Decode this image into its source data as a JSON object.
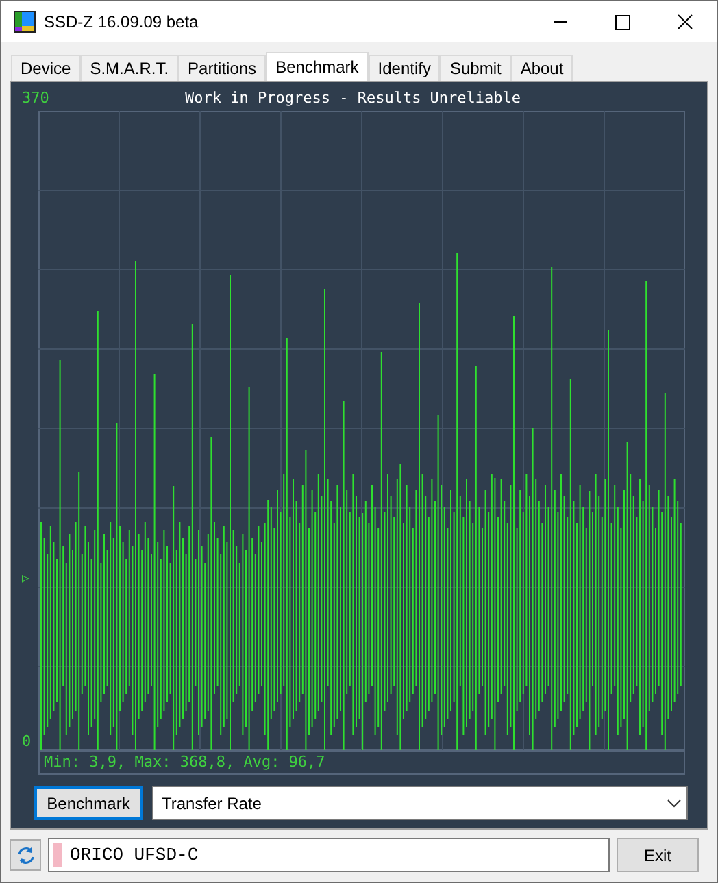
{
  "window": {
    "title": "SSD-Z 16.09.09 beta"
  },
  "tabs": [
    {
      "label": "Device",
      "selected": false
    },
    {
      "label": "S.M.A.R.T.",
      "selected": false
    },
    {
      "label": "Partitions",
      "selected": false
    },
    {
      "label": "Benchmark",
      "selected": true
    },
    {
      "label": "Identify",
      "selected": false
    },
    {
      "label": "Submit",
      "selected": false
    },
    {
      "label": "About",
      "selected": false
    }
  ],
  "graph": {
    "title": "Work in Progress - Results Unreliable",
    "y_max_label": "370",
    "y_min_label": "0",
    "marker": "▷",
    "stats": "Min: 3,9, Max: 368,8, Avg: 96,7"
  },
  "benchmark_button": "Benchmark",
  "test_select": {
    "value": "Transfer Rate"
  },
  "drive_field": {
    "value": "ORICO UFSD-C"
  },
  "exit_button": "Exit"
}
